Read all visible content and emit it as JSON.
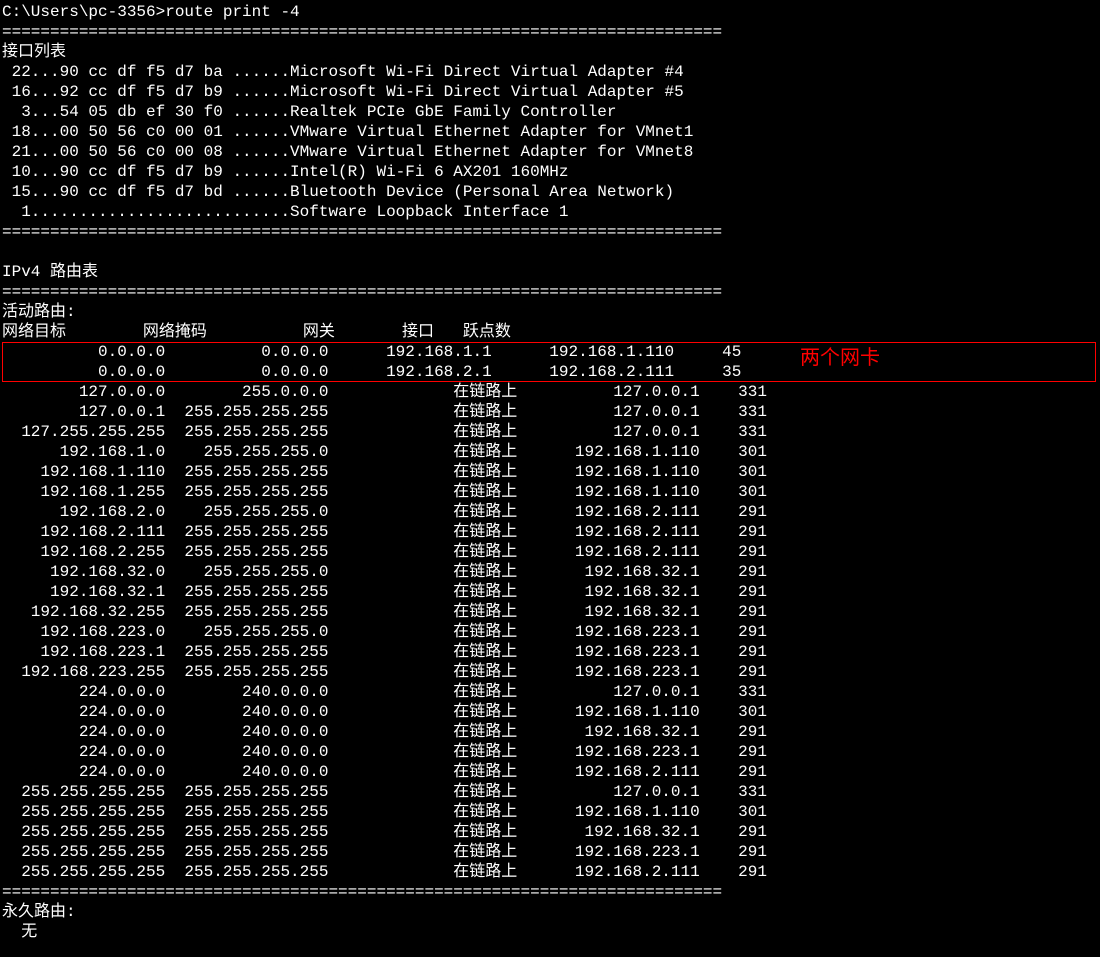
{
  "prompt": "C:\\Users\\pc-3356>",
  "command": "route print -4",
  "sep": "===========================================================================",
  "iface_title": "接口列表",
  "interfaces": [
    {
      "idx": " 22",
      "mac": "...90 cc df f5 d7 ba ......",
      "name": "Microsoft Wi-Fi Direct Virtual Adapter #4"
    },
    {
      "idx": " 16",
      "mac": "...92 cc df f5 d7 b9 ......",
      "name": "Microsoft Wi-Fi Direct Virtual Adapter #5"
    },
    {
      "idx": "  3",
      "mac": "...54 05 db ef 30 f0 ......",
      "name": "Realtek PCIe GbE Family Controller"
    },
    {
      "idx": " 18",
      "mac": "...00 50 56 c0 00 01 ......",
      "name": "VMware Virtual Ethernet Adapter for VMnet1"
    },
    {
      "idx": " 21",
      "mac": "...00 50 56 c0 00 08 ......",
      "name": "VMware Virtual Ethernet Adapter for VMnet8"
    },
    {
      "idx": " 10",
      "mac": "...90 cc df f5 d7 b9 ......",
      "name": "Intel(R) Wi-Fi 6 AX201 160MHz"
    },
    {
      "idx": " 15",
      "mac": "...90 cc df f5 d7 bd ......",
      "name": "Bluetooth Device (Personal Area Network)"
    },
    {
      "idx": "  1",
      "mac": "...........................",
      "name": "Software Loopback Interface 1"
    }
  ],
  "route_table_title": "IPv4 路由表",
  "active_routes_title": "活动路由:",
  "headers": {
    "dest": "网络目标",
    "mask": "网络掩码",
    "gw": "网关",
    "iface": "接口",
    "metric": "跃点数"
  },
  "highlight_routes": [
    {
      "dest": "0.0.0.0",
      "mask": "0.0.0.0",
      "gw": "192.168.1.1",
      "iface": "192.168.1.110",
      "metric": "45"
    },
    {
      "dest": "0.0.0.0",
      "mask": "0.0.0.0",
      "gw": "192.168.2.1",
      "iface": "192.168.2.111",
      "metric": "35"
    }
  ],
  "highlight_label": "两个网卡",
  "routes": [
    {
      "dest": "127.0.0.0",
      "mask": "255.0.0.0",
      "gw": "在链路上",
      "iface": "127.0.0.1",
      "metric": "331"
    },
    {
      "dest": "127.0.0.1",
      "mask": "255.255.255.255",
      "gw": "在链路上",
      "iface": "127.0.0.1",
      "metric": "331"
    },
    {
      "dest": "127.255.255.255",
      "mask": "255.255.255.255",
      "gw": "在链路上",
      "iface": "127.0.0.1",
      "metric": "331"
    },
    {
      "dest": "192.168.1.0",
      "mask": "255.255.255.0",
      "gw": "在链路上",
      "iface": "192.168.1.110",
      "metric": "301"
    },
    {
      "dest": "192.168.1.110",
      "mask": "255.255.255.255",
      "gw": "在链路上",
      "iface": "192.168.1.110",
      "metric": "301"
    },
    {
      "dest": "192.168.1.255",
      "mask": "255.255.255.255",
      "gw": "在链路上",
      "iface": "192.168.1.110",
      "metric": "301"
    },
    {
      "dest": "192.168.2.0",
      "mask": "255.255.255.0",
      "gw": "在链路上",
      "iface": "192.168.2.111",
      "metric": "291"
    },
    {
      "dest": "192.168.2.111",
      "mask": "255.255.255.255",
      "gw": "在链路上",
      "iface": "192.168.2.111",
      "metric": "291"
    },
    {
      "dest": "192.168.2.255",
      "mask": "255.255.255.255",
      "gw": "在链路上",
      "iface": "192.168.2.111",
      "metric": "291"
    },
    {
      "dest": "192.168.32.0",
      "mask": "255.255.255.0",
      "gw": "在链路上",
      "iface": "192.168.32.1",
      "metric": "291"
    },
    {
      "dest": "192.168.32.1",
      "mask": "255.255.255.255",
      "gw": "在链路上",
      "iface": "192.168.32.1",
      "metric": "291"
    },
    {
      "dest": "192.168.32.255",
      "mask": "255.255.255.255",
      "gw": "在链路上",
      "iface": "192.168.32.1",
      "metric": "291"
    },
    {
      "dest": "192.168.223.0",
      "mask": "255.255.255.0",
      "gw": "在链路上",
      "iface": "192.168.223.1",
      "metric": "291"
    },
    {
      "dest": "192.168.223.1",
      "mask": "255.255.255.255",
      "gw": "在链路上",
      "iface": "192.168.223.1",
      "metric": "291"
    },
    {
      "dest": "192.168.223.255",
      "mask": "255.255.255.255",
      "gw": "在链路上",
      "iface": "192.168.223.1",
      "metric": "291"
    },
    {
      "dest": "224.0.0.0",
      "mask": "240.0.0.0",
      "gw": "在链路上",
      "iface": "127.0.0.1",
      "metric": "331"
    },
    {
      "dest": "224.0.0.0",
      "mask": "240.0.0.0",
      "gw": "在链路上",
      "iface": "192.168.1.110",
      "metric": "301"
    },
    {
      "dest": "224.0.0.0",
      "mask": "240.0.0.0",
      "gw": "在链路上",
      "iface": "192.168.32.1",
      "metric": "291"
    },
    {
      "dest": "224.0.0.0",
      "mask": "240.0.0.0",
      "gw": "在链路上",
      "iface": "192.168.223.1",
      "metric": "291"
    },
    {
      "dest": "224.0.0.0",
      "mask": "240.0.0.0",
      "gw": "在链路上",
      "iface": "192.168.2.111",
      "metric": "291"
    },
    {
      "dest": "255.255.255.255",
      "mask": "255.255.255.255",
      "gw": "在链路上",
      "iface": "127.0.0.1",
      "metric": "331"
    },
    {
      "dest": "255.255.255.255",
      "mask": "255.255.255.255",
      "gw": "在链路上",
      "iface": "192.168.1.110",
      "metric": "301"
    },
    {
      "dest": "255.255.255.255",
      "mask": "255.255.255.255",
      "gw": "在链路上",
      "iface": "192.168.32.1",
      "metric": "291"
    },
    {
      "dest": "255.255.255.255",
      "mask": "255.255.255.255",
      "gw": "在链路上",
      "iface": "192.168.223.1",
      "metric": "291"
    },
    {
      "dest": "255.255.255.255",
      "mask": "255.255.255.255",
      "gw": "在链路上",
      "iface": "192.168.2.111",
      "metric": "291"
    }
  ],
  "perm_routes_title": "永久路由:",
  "perm_routes_none": "  无"
}
